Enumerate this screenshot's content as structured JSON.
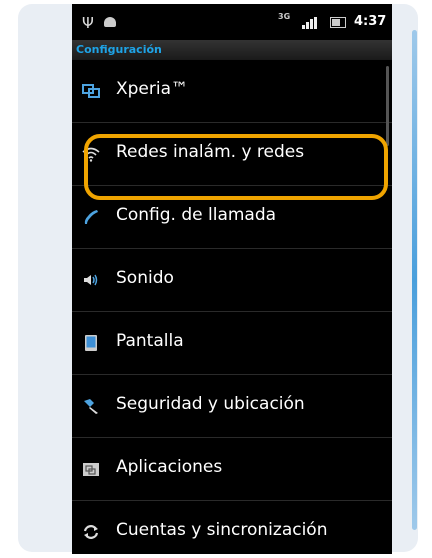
{
  "status_bar": {
    "network": "3G",
    "time": "4:37"
  },
  "header": {
    "title": "Configuración"
  },
  "settings": {
    "items": [
      {
        "label": "Xperia™",
        "icon": "xperia-icon"
      },
      {
        "label": "Redes inalám. y redes",
        "icon": "wifi-icon"
      },
      {
        "label": "Config. de llamada",
        "icon": "phone-handset-icon"
      },
      {
        "label": "Sonido",
        "icon": "speaker-icon"
      },
      {
        "label": "Pantalla",
        "icon": "display-icon"
      },
      {
        "label": "Seguridad y ubicación",
        "icon": "security-icon"
      },
      {
        "label": "Aplicaciones",
        "icon": "apps-icon"
      },
      {
        "label": "Cuentas y sincronización",
        "icon": "sync-icon"
      }
    ]
  },
  "colors": {
    "accent": "#1ea3e6",
    "highlight": "#f0a400",
    "background": "#000000"
  }
}
